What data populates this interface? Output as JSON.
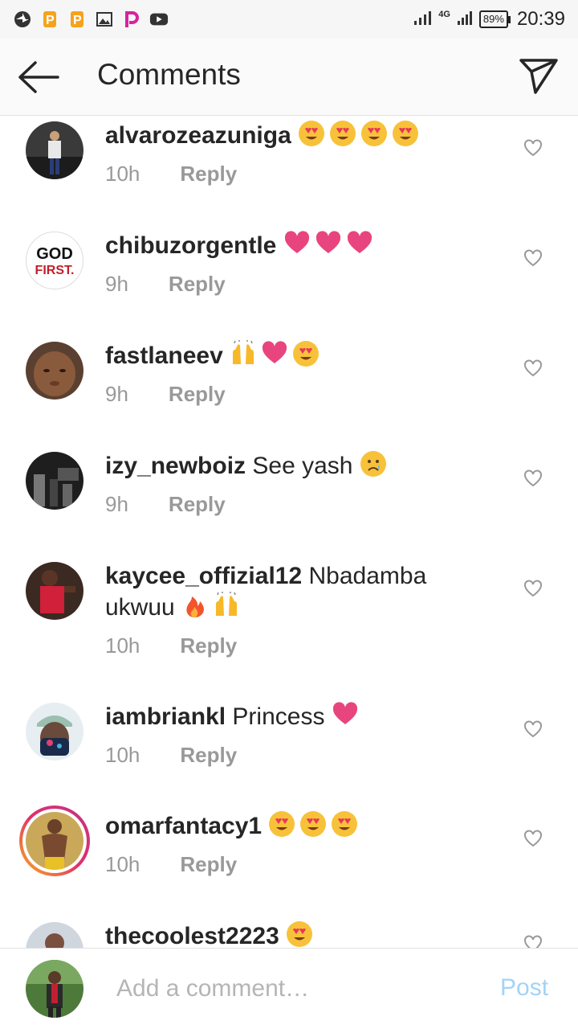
{
  "status_bar": {
    "network": "4G",
    "battery": "89%",
    "time": "20:39",
    "icons": [
      "pinwheel-icon",
      "p-app-icon",
      "p-app-icon",
      "gallery-icon",
      "picsart-icon",
      "youtube-icon"
    ]
  },
  "header": {
    "title": "Comments",
    "back_icon": "back-arrow-icon",
    "share_icon": "direct-send-icon"
  },
  "comments": [
    {
      "username": "alvarozeazuniga",
      "text": "",
      "emojis": [
        "heart-eyes",
        "heart-eyes",
        "heart-eyes",
        "heart-eyes"
      ],
      "time": "10h",
      "reply": "Reply"
    },
    {
      "username": "chibuzorgentle",
      "text": "",
      "emojis": [
        "pink-heart",
        "pink-heart",
        "pink-heart"
      ],
      "time": "9h",
      "reply": "Reply"
    },
    {
      "username": "fastlaneev",
      "text": "",
      "emojis": [
        "raised-hands",
        "pink-heart",
        "heart-eyes"
      ],
      "time": "9h",
      "reply": "Reply"
    },
    {
      "username": "izy_newboiz",
      "text": "See yash",
      "emojis": [
        "sad-face"
      ],
      "time": "9h",
      "reply": "Reply"
    },
    {
      "username": "kaycee_offizial12",
      "text": "Nbadamba ukwuu",
      "emojis": [
        "fire",
        "raised-hands"
      ],
      "time": "10h",
      "reply": "Reply"
    },
    {
      "username": "iambriankl",
      "text": "Princess",
      "emojis": [
        "pink-heart"
      ],
      "time": "10h",
      "reply": "Reply"
    },
    {
      "username": "omarfantacy1",
      "text": "",
      "emojis": [
        "heart-eyes",
        "heart-eyes",
        "heart-eyes"
      ],
      "time": "10h",
      "reply": "Reply"
    },
    {
      "username": "thecoolest2223",
      "text": "",
      "emojis": [
        "heart-eyes"
      ],
      "time": "",
      "reply": ""
    }
  ],
  "avatar_logo": {
    "line1": "GOD",
    "line2": "FIRST."
  },
  "composer": {
    "placeholder": "Add a comment…",
    "post_label": "Post"
  },
  "colors": {
    "post_disabled": "#a3d3f7",
    "muted_text": "#999999",
    "story_ring": "#e1306c"
  }
}
